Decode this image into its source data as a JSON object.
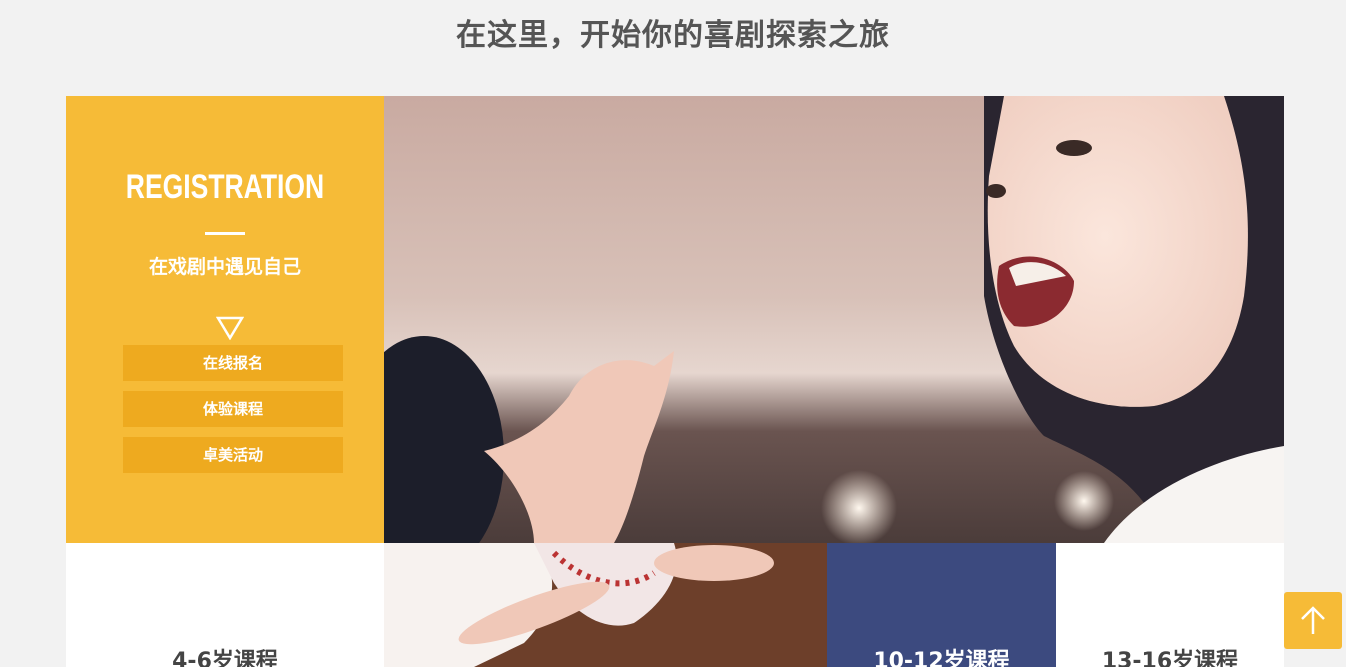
{
  "heading": "在这里，开始你的喜剧探索之旅",
  "registration": {
    "title": "REGISTRATION",
    "subtitle": "在戏剧中遇见自己",
    "buttons": [
      {
        "label": "在线报名"
      },
      {
        "label": "体验课程"
      },
      {
        "label": "卓美活动"
      }
    ]
  },
  "courses": [
    {
      "label": "4-6岁课程"
    },
    {
      "label": "10-12岁课程"
    },
    {
      "label": "13-16岁课程"
    }
  ],
  "icons": {
    "triangle": "triangle-down-icon",
    "scroll_top": "arrow-up-icon"
  },
  "colors": {
    "accent": "#f6bb37",
    "button": "#eeaa1f",
    "navy": "#3c4a7f",
    "heading": "#555555"
  }
}
